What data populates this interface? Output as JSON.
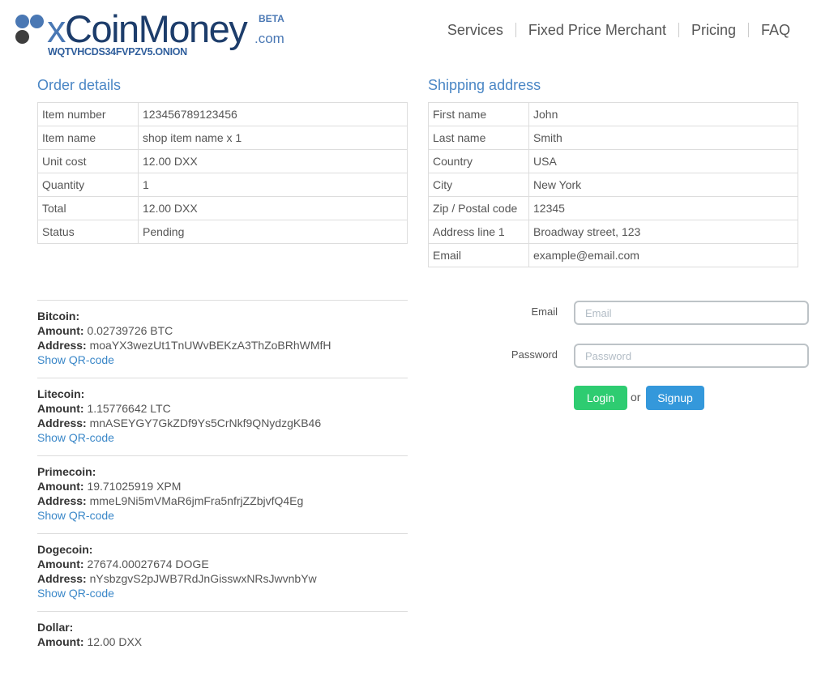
{
  "logo": {
    "brand_prefix": "x",
    "brand_main": "CoinMoney",
    "brand_tld": ".com",
    "badge": "BETA",
    "onion": "WQTVHCDS34FVPZV5.ONION"
  },
  "nav": {
    "services": "Services",
    "fixed_price": "Fixed Price Merchant",
    "pricing": "Pricing",
    "faq": "FAQ"
  },
  "order": {
    "title": "Order details",
    "rows": [
      {
        "label": "Item number",
        "value": "123456789123456"
      },
      {
        "label": "Item name",
        "value": "shop item name x 1"
      },
      {
        "label": "Unit cost",
        "value": "12.00 DXX"
      },
      {
        "label": "Quantity",
        "value": "1"
      },
      {
        "label": "Total",
        "value": "12.00 DXX"
      },
      {
        "label": "Status",
        "value": "Pending"
      }
    ]
  },
  "shipping": {
    "title": "Shipping address",
    "rows": [
      {
        "label": "First name",
        "value": "John"
      },
      {
        "label": "Last name",
        "value": "Smith"
      },
      {
        "label": "Country",
        "value": "USA"
      },
      {
        "label": "City",
        "value": "New York"
      },
      {
        "label": "Zip / Postal code",
        "value": "12345"
      },
      {
        "label": "Address line 1",
        "value": "Broadway street, 123"
      },
      {
        "label": "Email",
        "value": "example@email.com"
      }
    ]
  },
  "payments": {
    "amount_label": "Amount:",
    "address_label": "Address:",
    "qr_label": "Show QR-code",
    "items": [
      {
        "name": "Bitcoin:",
        "amount": "0.02739726 BTC",
        "address": "moaYX3wezUt1TnUWvBEKzA3ThZoBRhWMfH"
      },
      {
        "name": "Litecoin:",
        "amount": "1.15776642 LTC",
        "address": "mnASEYGY7GkZDf9Ys5CrNkf9QNydzgKB46"
      },
      {
        "name": "Primecoin:",
        "amount": "19.71025919 XPM",
        "address": "mmeL9Ni5mVMaR6jmFra5nfrjZZbjvfQ4Eg"
      },
      {
        "name": "Dogecoin:",
        "amount": "27674.00027674 DOGE",
        "address": "nYsbzgvS2pJWB7RdJnGisswxNRsJwvnbYw"
      },
      {
        "name": "Dollar:",
        "amount": "12.00 DXX"
      }
    ]
  },
  "login": {
    "email_label": "Email",
    "email_placeholder": "Email",
    "password_label": "Password",
    "password_placeholder": "Password",
    "login_button": "Login",
    "or_text": "or",
    "signup_button": "Signup"
  },
  "colors": {
    "accent": "#4a86c5",
    "login_green": "#2ecc71",
    "signup_blue": "#3498db"
  }
}
